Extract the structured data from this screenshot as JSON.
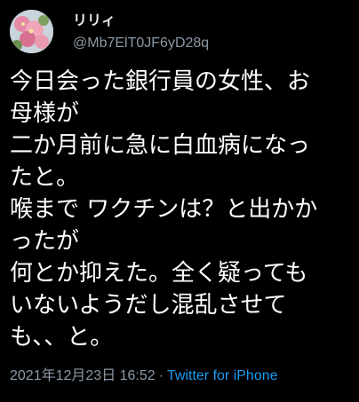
{
  "user": {
    "display_name": "リリィ",
    "handle": "@Mb7ElT0JF6yD28q",
    "avatar_icon": "avatar-photo-flowers"
  },
  "tweet": {
    "lines": [
      "今日会った銀行員の女性、お",
      "母様が",
      "二か月前に急に白血病になっ",
      "たと。",
      "喉まで ワクチンは？と出かか",
      "ったが",
      "何とか抑えた。全く疑っても",
      "いないようだし混乱させて",
      "も、、と。"
    ]
  },
  "meta": {
    "timestamp": "2021年12月23日 16:52",
    "separator": "·",
    "source": "Twitter for iPhone"
  },
  "colors": {
    "background": "#000000",
    "text": "#ffffff",
    "secondary": "#8b98a5",
    "link": "#1d9bf0"
  }
}
